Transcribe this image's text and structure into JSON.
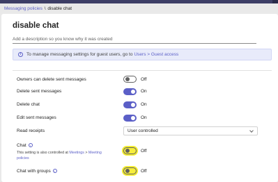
{
  "breadcrumb": {
    "parent": "Messaging policies",
    "separator": "\\",
    "current": "disable chat"
  },
  "page": {
    "title": "disable chat",
    "description_placeholder": "Add a description so you know why it was created"
  },
  "banner": {
    "text": "To manage messaging settings for guest users, go to ",
    "link_users": "Users",
    "arrow": " > ",
    "link_guest": "Guest access"
  },
  "settings": {
    "owners_delete": {
      "label": "Owners can delete sent messages",
      "state": "Off"
    },
    "delete_sent": {
      "label": "Delete sent messages",
      "state": "On"
    },
    "delete_chat": {
      "label": "Delete chat",
      "state": "On"
    },
    "edit_sent": {
      "label": "Edit sent messages",
      "state": "On"
    },
    "read_receipts": {
      "label": "Read receipts",
      "value": "User controlled"
    },
    "chat": {
      "label": "Chat",
      "note_text": "This setting is also controlled at ",
      "note_link1": "Meetings",
      "note_arrow": " > ",
      "note_link2": "Meeting",
      "note_link3": "policies",
      "state": "Off"
    },
    "chat_groups": {
      "label": "Chat with groups",
      "state": "Off"
    }
  },
  "colors": {
    "accent": "#5b5fc7",
    "highlight": "#f2ec2e",
    "topbar": "#3d3e66"
  }
}
